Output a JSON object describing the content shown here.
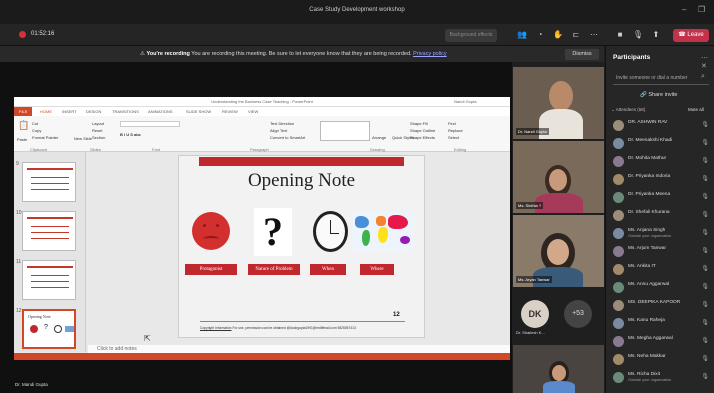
{
  "window": {
    "title": "Case Study Development workshop",
    "minimize_icon": "minimize-icon",
    "restore_icon": "restore-icon"
  },
  "meeting": {
    "timer": "01:52:16",
    "dark_button": "Background effects",
    "leave_label": "Leave",
    "recording": {
      "bold": "You're recording",
      "text": "You are recording this meeting. Be sure to let everyone know that they are being recorded.",
      "link": "Privacy policy",
      "dismiss": "Dismiss"
    },
    "presenter_name": "Dr. Mandi Gupta",
    "overflow_count": "+53",
    "overflow_initials": "DK"
  },
  "ppt": {
    "title": "Understanding the Business Case Teaching - PowerPoint",
    "user": "Nandi Gupta",
    "tabs": [
      "FILE",
      "HOME",
      "INSERT",
      "DESIGN",
      "TRANSITIONS",
      "ANIMATIONS",
      "SLIDE SHOW",
      "REVIEW",
      "VIEW"
    ],
    "groups": [
      "Clipboard",
      "Slides",
      "Font",
      "Paragraph",
      "Drawing",
      "Editing"
    ],
    "ribbon": {
      "cut": "Cut",
      "copy": "Copy",
      "format_painter": "Format Painter",
      "paste": "Paste",
      "new_slide": "New Slide",
      "layout": "Layout",
      "reset": "Reset",
      "section": "Section",
      "text_direction": "Text Direction",
      "align_text": "Align Text",
      "convert": "Convert to SmartArt",
      "arrange": "Arrange",
      "quick_styles": "Quick Styles",
      "shape_fill": "Shape Fill",
      "shape_outline": "Shape Outline",
      "shape_effects": "Shape Effects",
      "find": "Find",
      "replace": "Replace",
      "select": "Select"
    },
    "thumb_numbers": [
      "9",
      "10",
      "11",
      "12"
    ],
    "thumb_titles": [
      "Purpose",
      "Interests",
      "Dual Primacy",
      "Opening Note"
    ],
    "notes": "Click to add notes",
    "slide": {
      "title": "Opening Note",
      "labels": [
        "Protagonist",
        "Nature of Problem",
        "When",
        "Where"
      ],
      "page": "12",
      "footer_link": "Copyright Information",
      "footer_text": " For use, permission can be obtained @docbgupta1991@rediffmail.com 9825057413"
    }
  },
  "tiles": [
    {
      "name": "Dr. Nandi Gupta",
      "color": "#6b5d50"
    },
    {
      "name": "Ms. Sinthia ?",
      "color": "#7a6a5a"
    },
    {
      "name": "Ms. Aryan Tanwar",
      "color": "#8a7a6a"
    },
    {
      "name": "Dr. Shailesh K...",
      "color": "#2a2a2a"
    }
  ],
  "panel": {
    "title": "Participants",
    "invite_placeholder": "Invite someone or dial a number",
    "share_invite": "Share invite",
    "attendees_label": "Attendees (58)",
    "mute_all": "Mute all",
    "people": [
      {
        "name": "DR. ASHWIN RAV",
        "sub": ""
      },
      {
        "name": "Dr. Meenakshi Khadi",
        "sub": ""
      },
      {
        "name": "Dr. Mohita Mathur",
        "sub": ""
      },
      {
        "name": "Dr. Priyanka Indoria",
        "sub": ""
      },
      {
        "name": "Dr. Priyanka Meena",
        "sub": ""
      },
      {
        "name": "Dr. Shefali Khurana",
        "sub": ""
      },
      {
        "name": "Ms. Anjana Singh",
        "sub": "Outside your organization"
      },
      {
        "name": "Ms. Arjum Tanwar",
        "sub": ""
      },
      {
        "name": "Ms. Ankita IT",
        "sub": ""
      },
      {
        "name": "Ms. Annu Aggarwal",
        "sub": ""
      },
      {
        "name": "MS. DEEPIKA KAPOOR",
        "sub": ""
      },
      {
        "name": "Ms. Kanu Raheja",
        "sub": ""
      },
      {
        "name": "Ms. Megha Aggarwal",
        "sub": ""
      },
      {
        "name": "Ms. Neha Makkar",
        "sub": ""
      },
      {
        "name": "Ms. Richa Dixit",
        "sub": "Outside your organization"
      }
    ]
  }
}
